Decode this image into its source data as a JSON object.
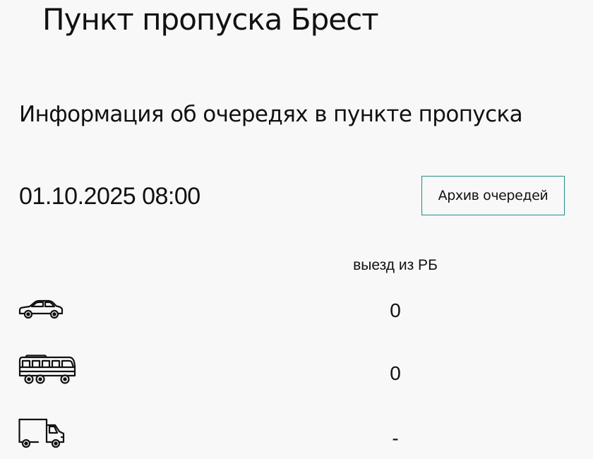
{
  "page": {
    "title": "Пункт пропуска Брест"
  },
  "info": {
    "heading": "Информация об очередях в пункте пропуска",
    "datetime": "01.10.2025 08:00",
    "archive_button_label": "Архив очередей"
  },
  "table": {
    "column_header": "выезд из РБ",
    "rows": [
      {
        "vehicle_icon": "car-icon",
        "value": "0"
      },
      {
        "vehicle_icon": "bus-icon",
        "value": "0"
      },
      {
        "vehicle_icon": "truck-icon",
        "value": "-"
      }
    ]
  },
  "colors": {
    "accent_border": "#1e8f82",
    "background": "#f8f8f8",
    "text": "#111111"
  }
}
